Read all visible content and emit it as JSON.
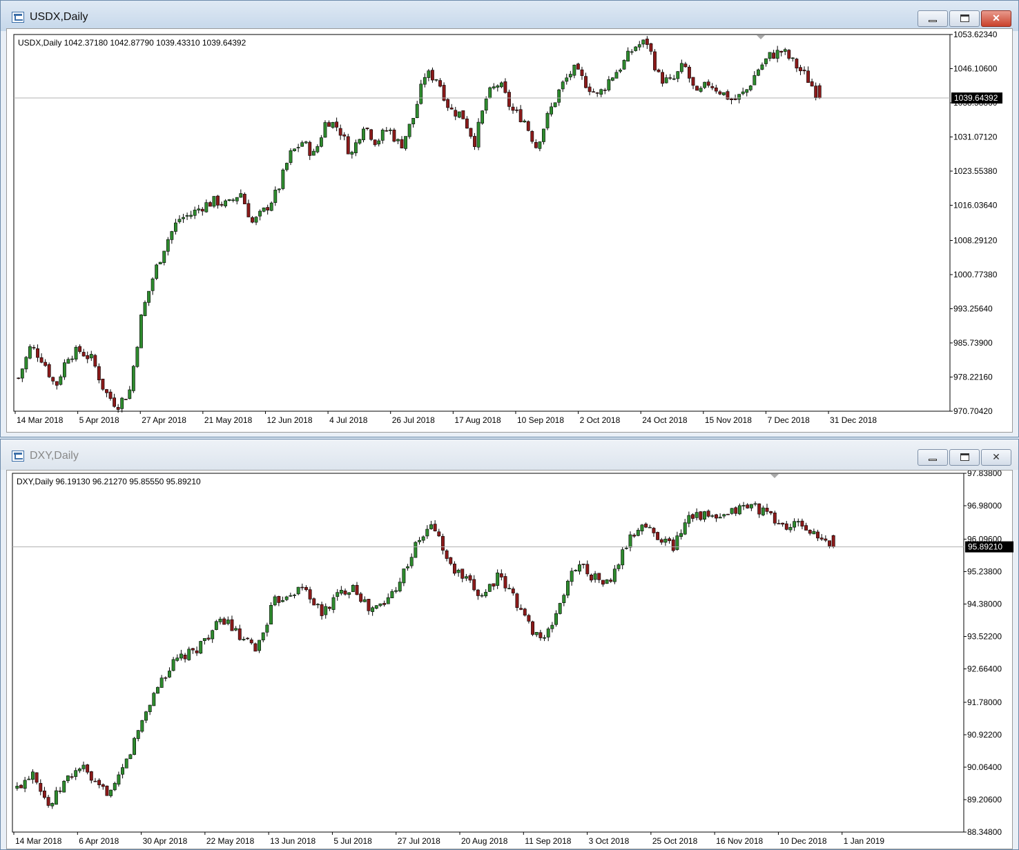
{
  "colors": {
    "bull": "#2e8b2e",
    "bear": "#8b1a1a",
    "wick": "#000000",
    "priceline": "#b0b0b0",
    "price_tag_bg": "#000000",
    "price_tag_fg": "#ffffff"
  },
  "windows": [
    {
      "title": "USDX,Daily",
      "ohlc_label": "USDX,Daily  1042.37180 1042.87790 1039.43310 1039.64392",
      "current_price": "1039.64392",
      "buttons": {
        "minimize": "minimize",
        "maximize": "maximize",
        "close": "close"
      }
    },
    {
      "title": "DXY,Daily",
      "ohlc_label": "DXY,Daily  96.19130 96.21270 95.85550 95.89210",
      "current_price": "95.89210",
      "buttons": {
        "minimize": "minimize",
        "maximize": "maximize",
        "close": "close"
      }
    }
  ],
  "chart_data": [
    {
      "type": "candlestick",
      "symbol": "USDX",
      "timeframe": "Daily",
      "ohlc_last": {
        "open": 1042.3718,
        "high": 1042.8779,
        "low": 1039.4331,
        "close": 1039.64392
      },
      "y_ticks": [
        "1053.62340",
        "1046.10600",
        "1038.58860",
        "1031.07120",
        "1023.55380",
        "1016.03640",
        "1008.29120",
        "1000.77380",
        "993.25640",
        "985.73900",
        "978.22160",
        "970.70420"
      ],
      "ylim": [
        970.7042,
        1053.6234
      ],
      "x_ticks": [
        "14 Mar 2018",
        "5 Apr 2018",
        "27 Apr 2018",
        "21 May 2018",
        "12 Jun 2018",
        "4 Jul 2018",
        "26 Jul 2018",
        "17 Aug 2018",
        "10 Sep 2018",
        "2 Oct 2018",
        "24 Oct 2018",
        "15 Nov 2018",
        "7 Dec 2018",
        "31 Dec 2018"
      ],
      "approx_closes": [
        978,
        985,
        982,
        976,
        983,
        984,
        982,
        975,
        972,
        975,
        992,
        1001,
        1008,
        1013,
        1014,
        1016,
        1017,
        1016,
        1019,
        1012,
        1015,
        1019,
        1027,
        1030,
        1027,
        1035,
        1033,
        1027,
        1034,
        1030,
        1033,
        1029,
        1035,
        1045,
        1044,
        1037,
        1036,
        1030,
        1040,
        1043,
        1037,
        1035,
        1029,
        1036,
        1042,
        1046,
        1043,
        1040,
        1044,
        1047,
        1051,
        1052,
        1044,
        1043,
        1047,
        1040,
        1043,
        1041,
        1039,
        1041,
        1046,
        1049,
        1050,
        1047,
        1044,
        1039.64
      ]
    },
    {
      "type": "candlestick",
      "symbol": "DXY",
      "timeframe": "Daily",
      "ohlc_last": {
        "open": 96.1913,
        "high": 96.2127,
        "low": 95.8555,
        "close": 95.8921
      },
      "y_ticks": [
        "97.83800",
        "96.98000",
        "96.09600",
        "95.23800",
        "94.38000",
        "93.52200",
        "92.66400",
        "91.78000",
        "90.92200",
        "90.06400",
        "89.20600",
        "88.34800"
      ],
      "ylim": [
        88.348,
        97.838
      ],
      "x_ticks": [
        "14 Mar 2018",
        "6 Apr 2018",
        "30 Apr 2018",
        "22 May 2018",
        "13 Jun 2018",
        "5 Jul 2018",
        "27 Jul 2018",
        "20 Aug 2018",
        "11 Sep 2018",
        "3 Oct 2018",
        "25 Oct 2018",
        "16 Nov 2018",
        "10 Dec 2018",
        "1 Jan 2019"
      ],
      "approx_closes": [
        89.5,
        90.0,
        89.0,
        89.7,
        90.1,
        89.5,
        89.4,
        90.4,
        91.5,
        92.4,
        92.9,
        93.1,
        93.6,
        94.0,
        93.4,
        93.2,
        94.4,
        94.7,
        94.8,
        94.1,
        94.6,
        94.9,
        94.2,
        94.4,
        95.1,
        96.0,
        96.5,
        95.4,
        95.0,
        94.6,
        95.1,
        94.6,
        93.8,
        93.4,
        94.5,
        95.5,
        95.1,
        94.9,
        95.9,
        96.5,
        96.2,
        95.9,
        96.8,
        96.7,
        96.6,
        96.9,
        97.0,
        96.7,
        96.4,
        96.5,
        96.1,
        95.89
      ]
    }
  ]
}
